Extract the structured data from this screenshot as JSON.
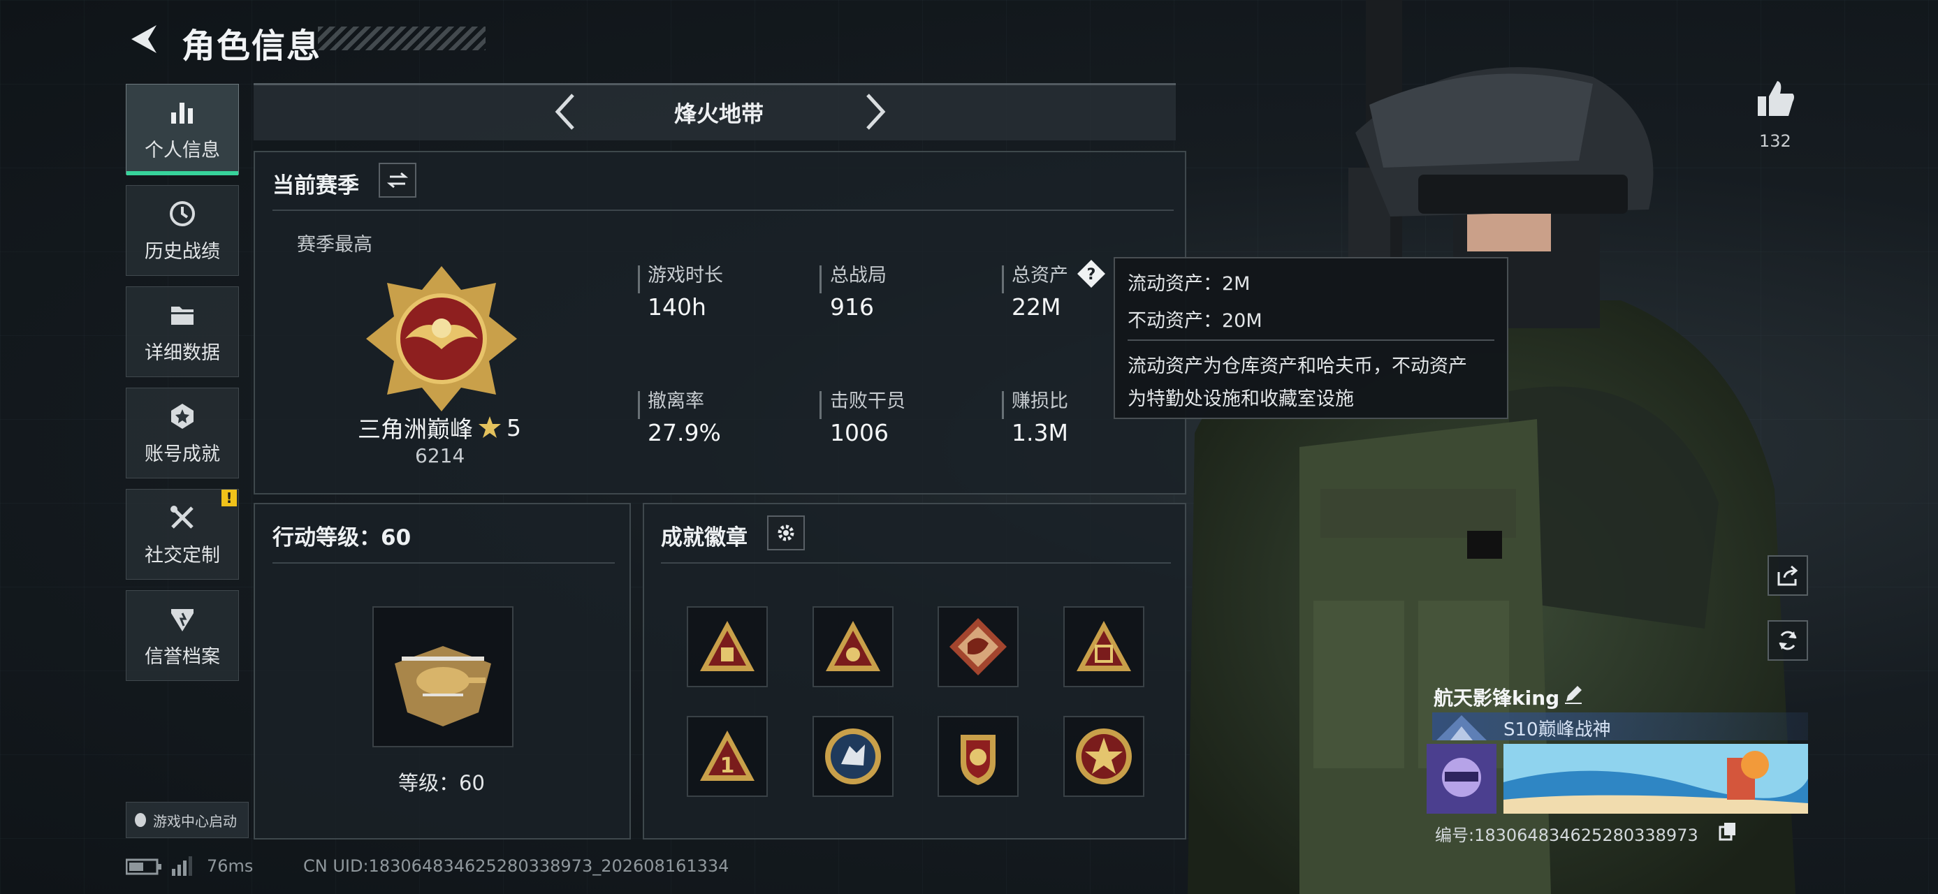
{
  "header": {
    "title": "角色信息"
  },
  "sidebar": {
    "items": [
      {
        "label": "个人信息",
        "icon": "bar-chart-icon",
        "active": true
      },
      {
        "label": "历史战绩",
        "icon": "clock-icon"
      },
      {
        "label": "详细数据",
        "icon": "folder-icon"
      },
      {
        "label": "账号成就",
        "icon": "achievement-icon"
      },
      {
        "label": "社交定制",
        "icon": "tools-icon",
        "alert": "!"
      },
      {
        "label": "信誉档案",
        "icon": "shield-icon"
      }
    ],
    "launcher_label": "游戏中心启动"
  },
  "mode": {
    "title": "烽火地带"
  },
  "season": {
    "section_title": "当前赛季",
    "best_label": "赛季最高",
    "rank_name": "三角洲巅峰",
    "rank_stars": "5",
    "rank_points": "6214",
    "stats": [
      {
        "label": "游戏时长",
        "value": "140h"
      },
      {
        "label": "总战局",
        "value": "916"
      },
      {
        "label": "总资产",
        "value": "22M"
      },
      {
        "label": "撤离率",
        "value": "27.9%"
      },
      {
        "label": "击败干员",
        "value": "1006"
      },
      {
        "label": "赚损比",
        "value": "1.3M"
      }
    ]
  },
  "tooltip": {
    "line1": "流动资产：2M",
    "line2": "不动资产：20M",
    "desc1": "流动资产为仓库资产和哈夫币，不动资产",
    "desc2": "为特勤处设施和收藏室设施"
  },
  "level": {
    "section_title": "行动等级：60",
    "caption": "等级：60"
  },
  "badges": {
    "section_title": "成就徽章",
    "count": 8
  },
  "profile": {
    "likes": "132",
    "player_name": "航天影锋king",
    "title": "S10巅峰战神",
    "id_line": "编号:183064834625280338973"
  },
  "status": {
    "ping": "76ms",
    "uid": "CN UID:183064834625280338973_202608161334"
  },
  "colors": {
    "accent": "#37d39b",
    "alert": "#f0c21a",
    "gold": "#c9a04a",
    "crimson": "#8e1f1f"
  }
}
